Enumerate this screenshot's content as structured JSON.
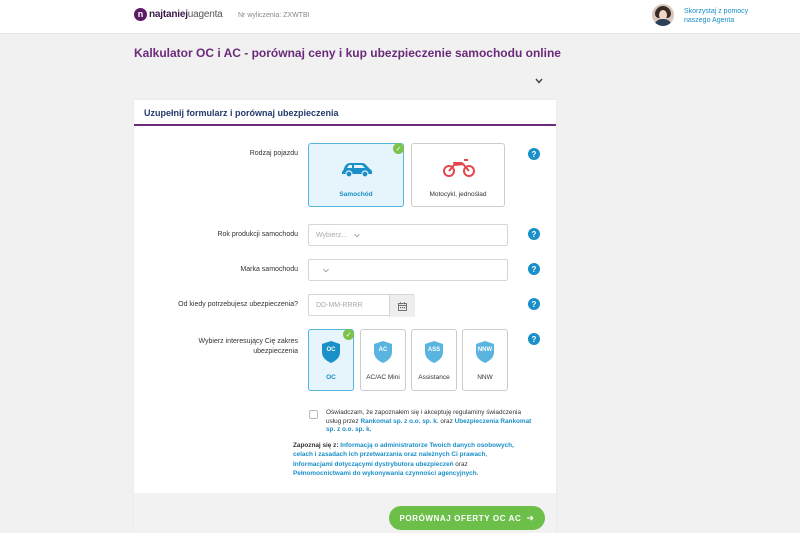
{
  "header": {
    "logo_mark": "n",
    "logo_brand": "najtaniej",
    "logo_agent": "uagenta",
    "calc_number": "Nr wyliczenia: ZXWTBI",
    "agent_help": "Skorzystaj z pomocy naszego Agenta"
  },
  "page": {
    "title": "Kalkulator OC i AC - porównaj ceny i kup ubezpieczenie samochodu online"
  },
  "form": {
    "header": "Uzupełnij formularz i porównaj ubezpieczenia",
    "vehicle": {
      "label": "Rodzaj pojazdu",
      "options": [
        {
          "label": "Samochód",
          "icon": "car-icon",
          "selected": true
        },
        {
          "label": "Motocykl, jednoślad",
          "icon": "motorcycle-icon",
          "selected": false
        }
      ]
    },
    "year": {
      "label": "Rok produkcji samochodu",
      "placeholder": "Wybierz..."
    },
    "make": {
      "label": "Marka samochodu",
      "placeholder": ""
    },
    "date": {
      "label": "Od kiedy potrzebujesz ubezpieczenia?",
      "placeholder": "DD-MM-RRRR"
    },
    "scope": {
      "label": "Wybierz interesujący Cię zakres ubezpieczenia",
      "options": [
        {
          "badge": "OC",
          "label": "OC",
          "selected": true
        },
        {
          "badge": "AC",
          "label": "AC/AC Mini",
          "selected": false
        },
        {
          "badge": "ASS",
          "label": "Assistance",
          "selected": false
        },
        {
          "badge": "NNW",
          "label": "NNW",
          "selected": false
        }
      ]
    },
    "help_glyph": "?",
    "check_glyph": "✓",
    "consent": {
      "text_before": "Oświadczam, że zapoznałem się i akceptuję regulaminy świadczenia usług przez ",
      "link1": "Rankomat sp. z o.o. sp. k.",
      "text_mid": " oraz ",
      "link2": "Ubezpieczenia Rankomat sp. z o.o. sp. k."
    },
    "info": {
      "prefix": "Zapoznaj się z: ",
      "link1": "Informacją o administratorze Twoich danych osobowych, celach i zasadach ich przetwarzania oraz należnych Ci prawach",
      "sep1": ", ",
      "link2": "Informacjami dotyczącymi dystrybutora ubezpieczeń",
      "sep2": " oraz ",
      "link3": "Pełnomocnictwami do wykonywania czynności agencyjnych",
      "suffix": "."
    },
    "submit_label": "PORÓWNAJ OFERTY OC AC",
    "submit_arrow": "➜"
  },
  "colors": {
    "brand_purple": "#6b2a7a",
    "accent_blue": "#1a8fc8",
    "success_green": "#6cc04a"
  }
}
